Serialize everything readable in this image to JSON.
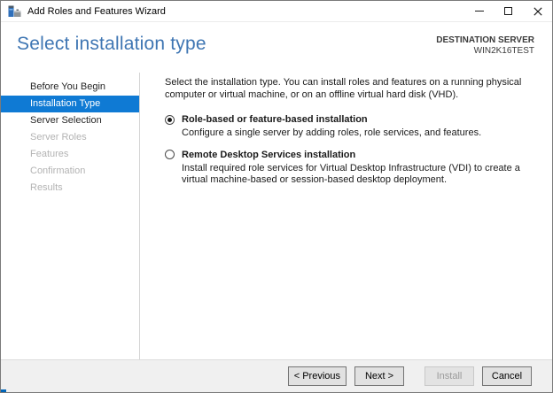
{
  "window": {
    "title": "Add Roles and Features Wizard"
  },
  "header": {
    "title": "Select installation type",
    "destination_label": "DESTINATION SERVER",
    "destination_server": "WIN2K16TEST"
  },
  "sidebar": {
    "items": [
      {
        "label": "Before You Begin",
        "state": "enabled"
      },
      {
        "label": "Installation Type",
        "state": "selected"
      },
      {
        "label": "Server Selection",
        "state": "enabled"
      },
      {
        "label": "Server Roles",
        "state": "disabled"
      },
      {
        "label": "Features",
        "state": "disabled"
      },
      {
        "label": "Confirmation",
        "state": "disabled"
      },
      {
        "label": "Results",
        "state": "disabled"
      }
    ]
  },
  "content": {
    "intro": "Select the installation type. You can install roles and features on a running physical computer or virtual machine, or on an offline virtual hard disk (VHD).",
    "options": [
      {
        "label": "Role-based or feature-based installation",
        "description": "Configure a single server by adding roles, role services, and features.",
        "selected": true
      },
      {
        "label": "Remote Desktop Services installation",
        "description": "Install required role services for Virtual Desktop Infrastructure (VDI) to create a virtual machine-based or session-based desktop deployment.",
        "selected": false
      }
    ]
  },
  "footer": {
    "buttons": [
      {
        "label": "< Previous",
        "enabled": true
      },
      {
        "label": "Next >",
        "enabled": true
      },
      {
        "label": "Install",
        "enabled": false
      },
      {
        "label": "Cancel",
        "enabled": true
      }
    ]
  },
  "colors": {
    "sidebar_selected_bg": "#0F7AD4",
    "heading_blue": "#3F76B3",
    "footer_bg": "#F0F0F0",
    "disabled_text": "#B3B3B3",
    "corner_artifact_blue": "#0065B8"
  }
}
